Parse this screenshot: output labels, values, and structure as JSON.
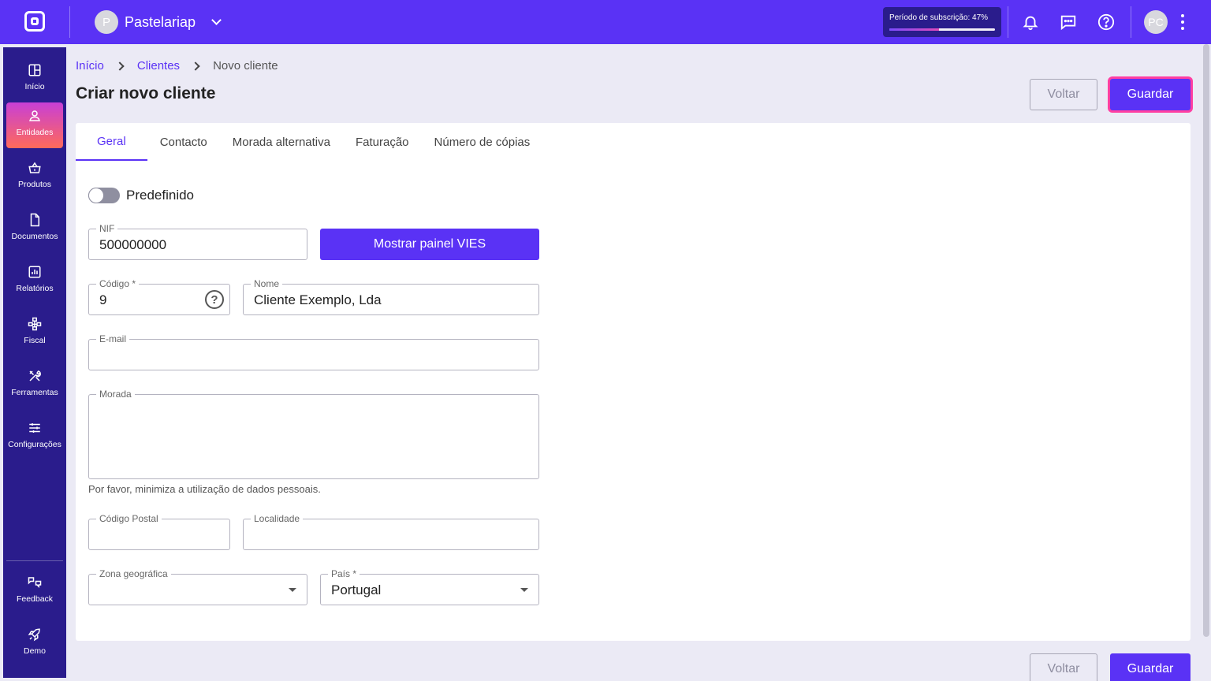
{
  "header": {
    "company_initial": "P",
    "company_name": "Pastelariap",
    "subscription_label": "Período de subscrição: 47%",
    "subscription_progress": 0.47,
    "user_initials": "PC",
    "icons": [
      "bell-icon",
      "chat-icon",
      "help-icon",
      "more-vertical-icon"
    ]
  },
  "sidebar": {
    "items": [
      {
        "label": "Início",
        "icon": "grid-icon"
      },
      {
        "label": "Entidades",
        "icon": "person-icon",
        "active": true
      },
      {
        "label": "Produtos",
        "icon": "basket-icon"
      },
      {
        "label": "Documentos",
        "icon": "document-icon"
      },
      {
        "label": "Relatórios",
        "icon": "chart-icon"
      },
      {
        "label": "Fiscal",
        "icon": "hierarchy-icon"
      },
      {
        "label": "Ferramentas",
        "icon": "tools-icon"
      },
      {
        "label": "Configurações",
        "icon": "sliders-icon"
      }
    ],
    "bottom_items": [
      {
        "label": "Feedback",
        "icon": "feedback-icon"
      },
      {
        "label": "Demo",
        "icon": "rocket-icon"
      }
    ]
  },
  "breadcrumb": {
    "home": "Início",
    "parent": "Clientes",
    "current": "Novo cliente"
  },
  "page": {
    "title": "Criar novo cliente",
    "back_label": "Voltar",
    "save_label": "Guardar"
  },
  "tabs": [
    "Geral",
    "Contacto",
    "Morada alternativa",
    "Faturação",
    "Número de cópias"
  ],
  "form": {
    "default_toggle_label": "Predefinido",
    "nif": {
      "label": "NIF",
      "value": "500000000"
    },
    "vies_button": "Mostrar painel VIES",
    "codigo": {
      "label": "Código *",
      "value": "9"
    },
    "nome": {
      "label": "Nome",
      "value": "Cliente Exemplo, Lda"
    },
    "email": {
      "label": "E-mail",
      "value": ""
    },
    "morada": {
      "label": "Morada",
      "value": ""
    },
    "helper": "Por favor, minimiza a utilização de dados pessoais.",
    "codigo_postal": {
      "label": "Código Postal",
      "value": ""
    },
    "localidade": {
      "label": "Localidade",
      "value": ""
    },
    "zona": {
      "label": "Zona geográfica",
      "value": ""
    },
    "pais": {
      "label": "País *",
      "value": "Portugal"
    }
  },
  "colors": {
    "primary": "#5a32f5",
    "sidebar": "#2a1c8c",
    "focus_ring": "#ff3fa2"
  }
}
